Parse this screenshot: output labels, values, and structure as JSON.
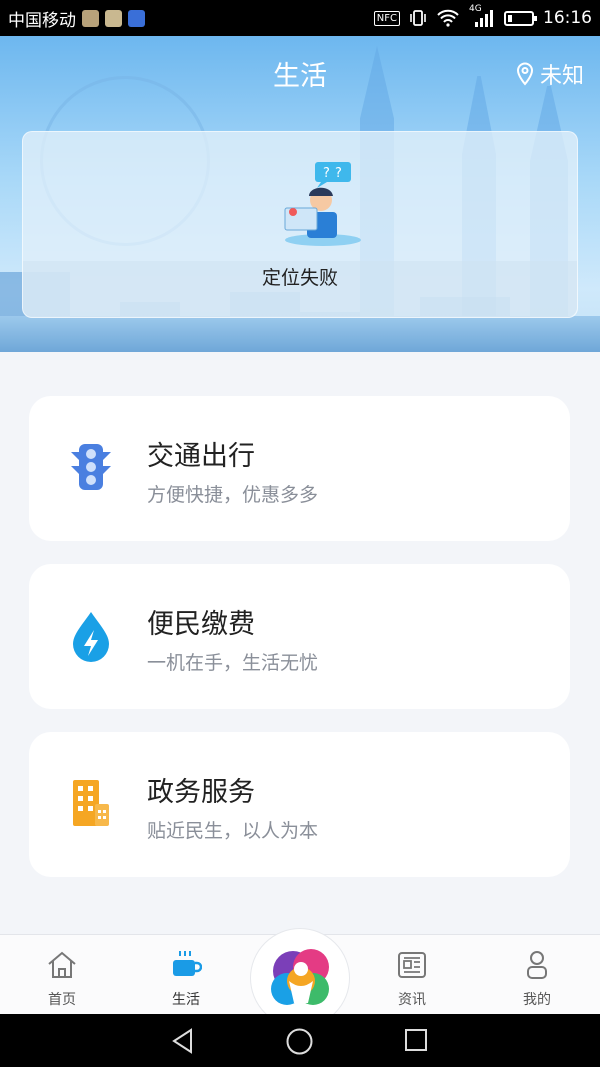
{
  "status_bar": {
    "carrier": "中国移动",
    "nfc": "NFC",
    "network": "4G",
    "time": "16:16",
    "battery_level": 0.2
  },
  "header": {
    "title": "生活",
    "location": "未知"
  },
  "location_card": {
    "status": "定位失败"
  },
  "services": [
    {
      "title": "交通出行",
      "subtitle": "方便快捷，优惠多多",
      "icon": "traffic-light-icon",
      "color": "#4a7fe0"
    },
    {
      "title": "便民缴费",
      "subtitle": "一机在手，生活无忧",
      "icon": "water-drop-bolt-icon",
      "color": "#1aa0e6"
    },
    {
      "title": "政务服务",
      "subtitle": "贴近民生，以人为本",
      "icon": "building-icon",
      "color": "#f5a623"
    }
  ],
  "tabbar": {
    "items": [
      {
        "label": "首页",
        "icon": "home-icon",
        "active": false
      },
      {
        "label": "生活",
        "icon": "coffee-cup-icon",
        "active": true
      },
      {
        "label": "资讯",
        "icon": "news-icon",
        "active": false
      },
      {
        "label": "我的",
        "icon": "person-icon",
        "active": false
      }
    ],
    "active_color": "#1a9be6"
  }
}
